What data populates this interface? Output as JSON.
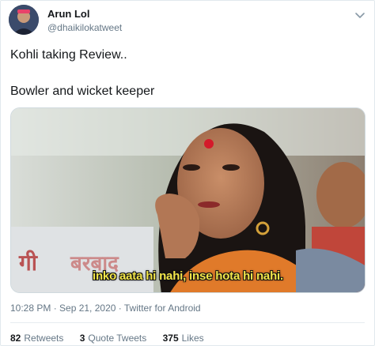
{
  "tweet": {
    "author_name": "Arun Lol",
    "author_handle": "@dhaikilokatweet",
    "text_line1": "Kohli taking Review..",
    "text_line2": "Bowler and wicket keeper",
    "media_caption": "inko aata hi nahi, inse hota hi nahi.",
    "timestamp": "10:28 PM · Sep 21, 2020 · ",
    "source": "Twitter for Android",
    "stats": [
      {
        "count": "82",
        "label": "Retweets"
      },
      {
        "count": "3",
        "label": "Quote Tweets"
      },
      {
        "count": "375",
        "label": "Likes"
      }
    ]
  },
  "icons": {
    "more": "chevron-down-icon",
    "avatar": "user-avatar"
  },
  "colors": {
    "text": "#14171a",
    "secondary": "#657786",
    "caption": "#f3e64a",
    "border": "#e1e8ed"
  }
}
